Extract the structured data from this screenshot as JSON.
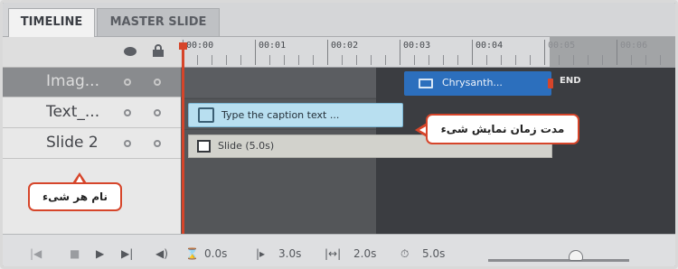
{
  "tabs": [
    {
      "label": "TIMELINE",
      "active": true
    },
    {
      "label": "MASTER SLIDE",
      "active": false
    }
  ],
  "layers": [
    {
      "name": "Imag...",
      "selected": true
    },
    {
      "name": "Text_...",
      "selected": false
    },
    {
      "name": "Slide 2",
      "selected": false
    }
  ],
  "ruler": {
    "labels": [
      "00:00",
      "00:01",
      "00:02",
      "00:03",
      "00:04",
      "00:05",
      "00:06"
    ]
  },
  "clips": {
    "image_label": "Chrysanth...",
    "end_label": "END",
    "caption_label": "Type the caption text ...",
    "slide_label": "Slide (5.0s)"
  },
  "callouts": {
    "layer_name": "نام هر شیء",
    "display_duration": "مدت زمان نمایش شیء"
  },
  "controls": {
    "current_time": "0.0s",
    "start_time": "3.0s",
    "duration": "2.0s",
    "total_time": "5.0s",
    "zoom_level": 0.62
  },
  "colors": {
    "accent": "#d6452a",
    "image_clip": "#2c6fbd",
    "caption_clip": "#b8dff0",
    "slide_clip": "#d2d2cc"
  }
}
